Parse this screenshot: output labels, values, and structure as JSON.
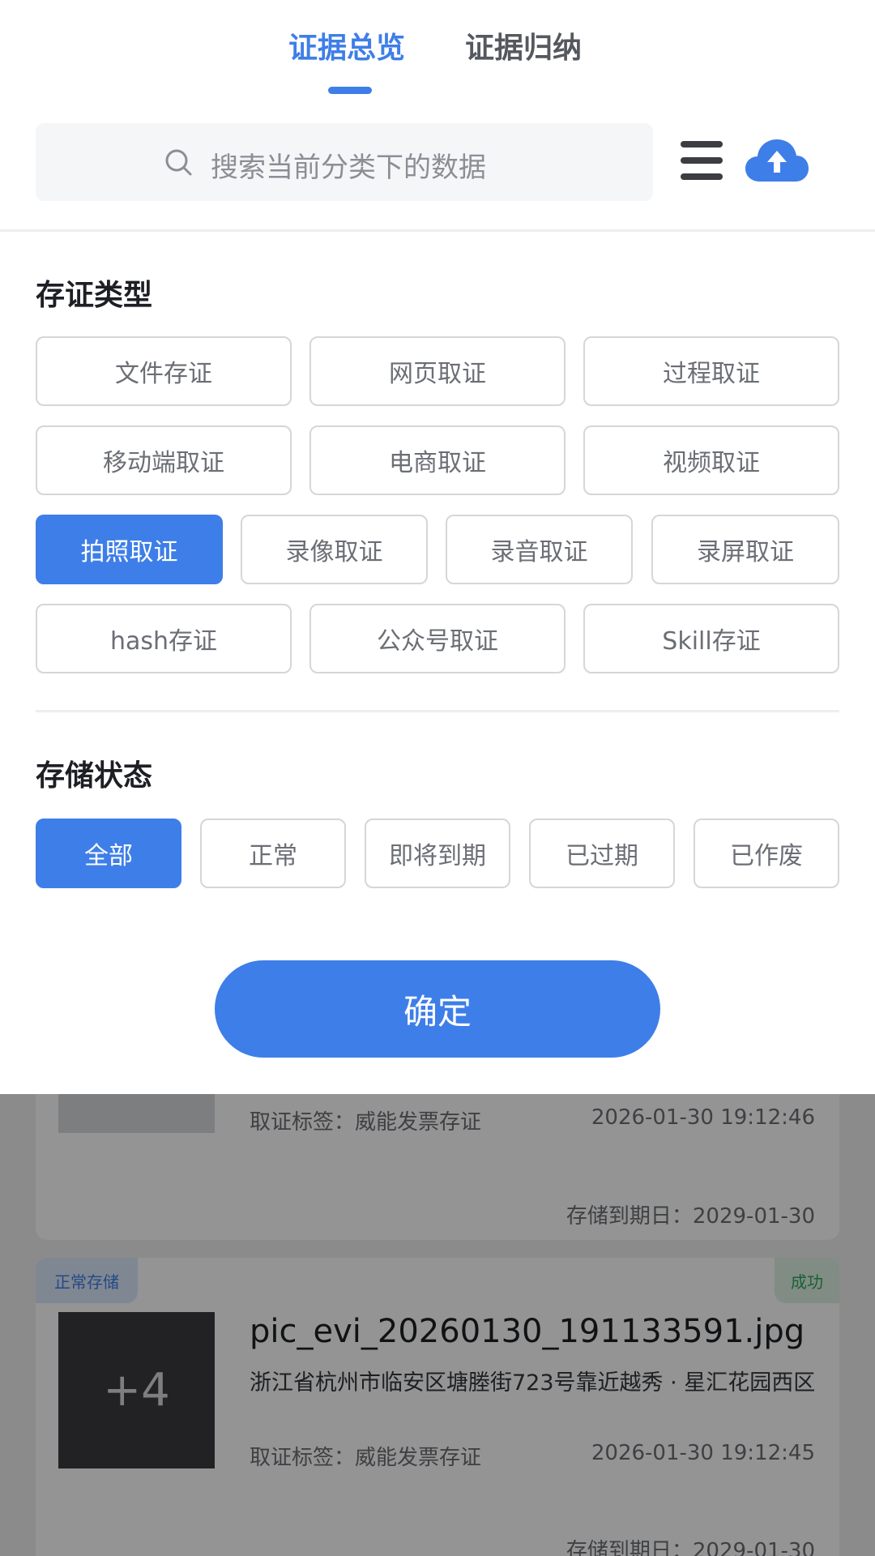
{
  "tabs": {
    "overview": "证据总览",
    "summary": "证据归纳"
  },
  "search": {
    "placeholder": "搜索当前分类下的数据"
  },
  "filter": {
    "type_title": "存证类型",
    "types": [
      "文件存证",
      "网页取证",
      "过程取证",
      "移动端取证",
      "电商取证",
      "视频取证",
      "拍照取证",
      "录像取证",
      "录音取证",
      "录屏取证",
      "hash存证",
      "公众号取证",
      "Skill存证"
    ],
    "selected_type": "拍照取证",
    "status_title": "存储状态",
    "statuses": [
      "全部",
      "正常",
      "即将到期",
      "已过期",
      "已作废"
    ],
    "selected_status": "全部",
    "confirm_label": "确定"
  },
  "list": {
    "items": [
      {
        "tag_label": "取证标签：威能发票存证",
        "time": "2026-01-30 19:12:46",
        "expiry": "存储到期日：2029-01-30"
      },
      {
        "storage_badge": "正常存储",
        "result_badge": "成功",
        "thumb_more": "+4",
        "file_name": "pic_evi_20260130_191133591.jpg",
        "address": "浙江省杭州市临安区塘塍街723号靠近越秀 · 星汇花园西区",
        "tag_label": "取证标签：威能发票存证",
        "time": "2026-01-30 19:12:45",
        "expiry": "存储到期日：2029-01-30"
      }
    ]
  },
  "colors": {
    "accent": "#3e7ee8",
    "success": "#2ea55a"
  },
  "icons": {
    "search": "search-icon",
    "menu": "menu-icon",
    "upload": "cloud-upload-icon"
  }
}
